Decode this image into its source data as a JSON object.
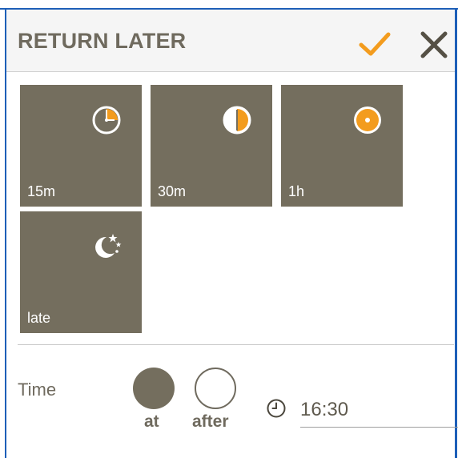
{
  "dialog": {
    "title": "RETURN LATER",
    "confirm_icon": "checkmark-icon",
    "close_icon": "close-icon"
  },
  "tiles": [
    {
      "label": "15m",
      "icon": "clock-quarter-icon"
    },
    {
      "label": "30m",
      "icon": "clock-half-icon"
    },
    {
      "label": "1h",
      "icon": "clock-full-icon"
    },
    {
      "label": "late",
      "icon": "moon-stars-icon"
    }
  ],
  "time": {
    "label": "Time",
    "option_at": "at",
    "option_after": "after",
    "selected": "at",
    "clock_icon": "clock-icon",
    "value": "16:30"
  },
  "colors": {
    "tile_bg": "#746e5e",
    "accent": "#f39c1e",
    "text": "#6f6a5e",
    "frame": "#1d5fb8"
  }
}
